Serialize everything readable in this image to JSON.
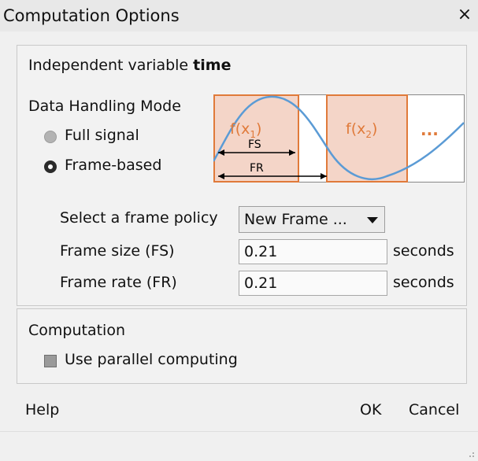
{
  "window": {
    "title": "Computation Options",
    "close_glyph": "×"
  },
  "options": {
    "independent_label": "Independent variable",
    "independent_value": "time",
    "data_handling_label": "Data Handling Mode",
    "radios": [
      {
        "label": "Full signal",
        "selected": false
      },
      {
        "label": "Frame-based",
        "selected": true
      }
    ],
    "diagram": {
      "frame1_label": "f(x",
      "frame1_sub": "1",
      "frame2_label": "f(x",
      "frame2_sub": "2",
      "ellipsis": "...",
      "fs_label": "FS",
      "fr_label": "FR",
      "frame_color": "#f4d5c8",
      "frame_border": "#e07a3a",
      "text_color": "#e07a3a",
      "curve_color": "#5b9bd5"
    },
    "frame_policy_label": "Select a frame policy",
    "frame_policy_value": "New Frame ...",
    "frame_size_label": "Frame size (FS)",
    "frame_size_value": "0.21",
    "frame_size_unit": "seconds",
    "frame_rate_label": "Frame rate (FR)",
    "frame_rate_value": "0.21",
    "frame_rate_unit": "seconds"
  },
  "computation": {
    "section_label": "Computation",
    "parallel_label": "Use parallel computing",
    "parallel_checked": false
  },
  "footer": {
    "help_label": "Help",
    "ok_label": "OK",
    "cancel_label": "Cancel"
  }
}
